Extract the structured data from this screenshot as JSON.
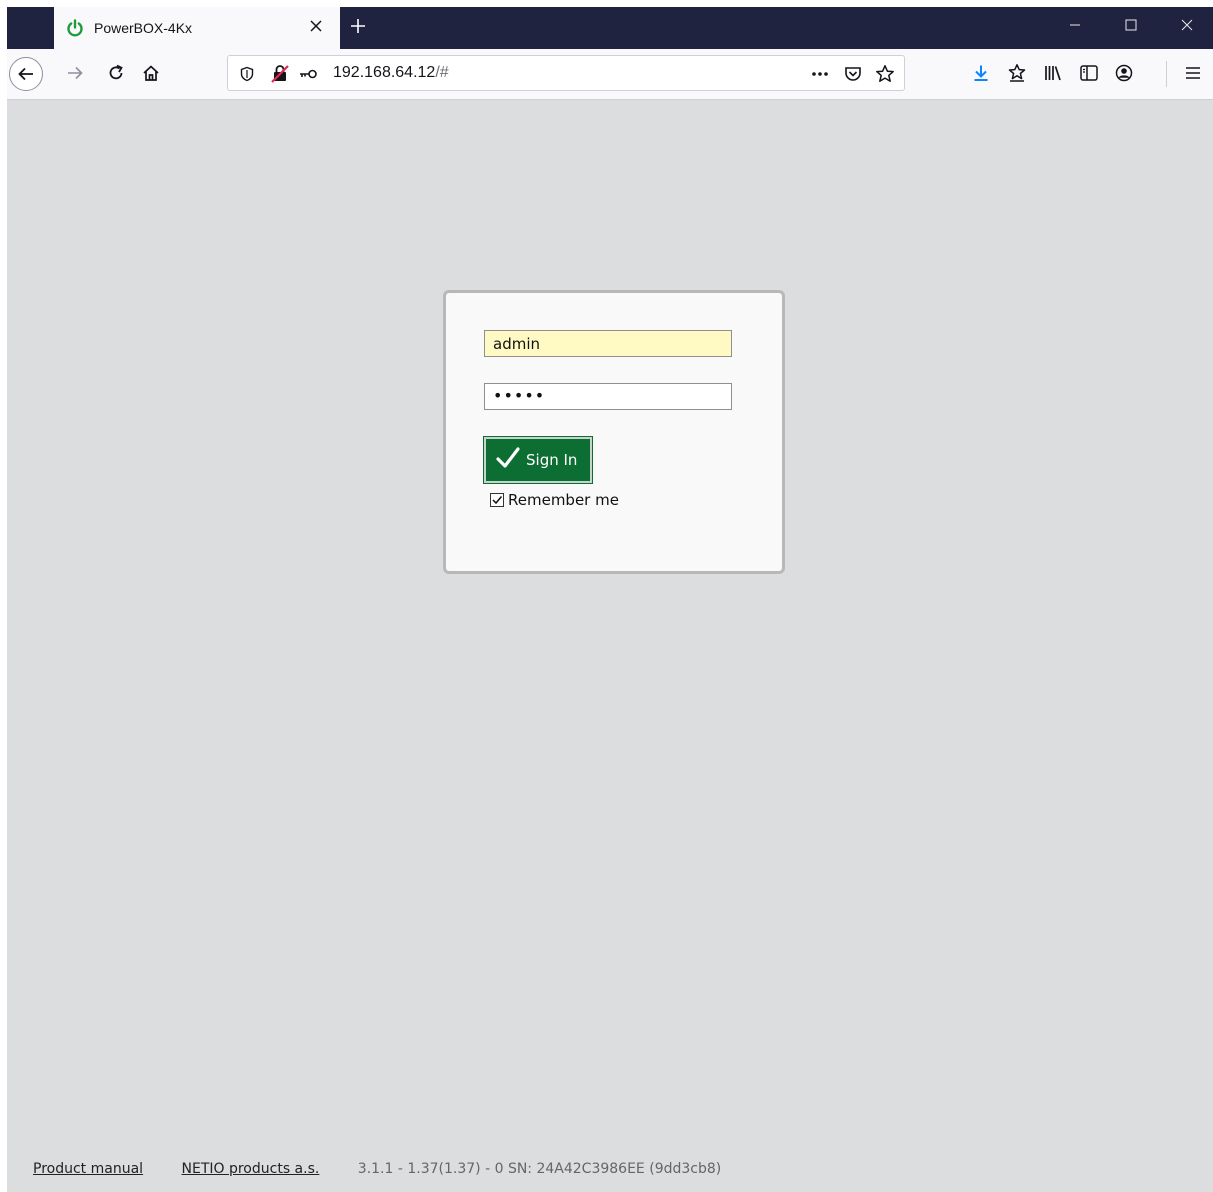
{
  "browser": {
    "tab_title": "PowerBOX-4Kx",
    "url_host": "192.168.64.12",
    "url_path": "/#",
    "accent_color": "#202340"
  },
  "login": {
    "username_value": "admin",
    "password_value": "•••••",
    "signin_label": "Sign In",
    "remember_label": "Remember me",
    "remember_checked": true,
    "button_color": "#0d6e33"
  },
  "footer": {
    "manual_link": "Product manual",
    "company_link": "NETIO products a.s.",
    "version_text": "3.1.1 - 1.37(1.37) - 0 SN: 24A42C3986EE (9dd3cb8)"
  }
}
